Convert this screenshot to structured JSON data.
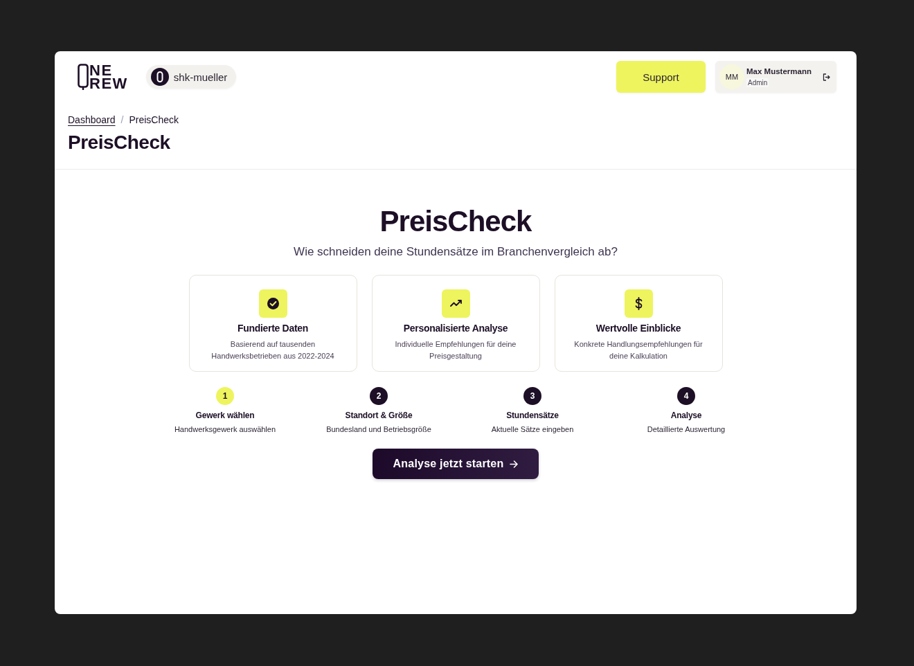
{
  "header": {
    "logo": {
      "top": "NE",
      "bottom": "REW"
    },
    "workspace": "shk-mueller",
    "support_button": "Support",
    "user": {
      "initials": "MM",
      "name": "Max Mustermann",
      "role": "Admin"
    }
  },
  "breadcrumb": {
    "items": [
      {
        "label": "Dashboard",
        "link": true
      },
      {
        "label": "PreisCheck",
        "link": false
      }
    ],
    "separator": "/"
  },
  "page_title": "PreisCheck",
  "hero": {
    "title": "PreisCheck",
    "subtitle": "Wie schneiden deine Stundensätze im Branchenvergleich ab?"
  },
  "features": [
    {
      "title": "Fundierte Daten",
      "description": "Basierend auf tausenden Handwerksbetrieben aus 2022-2024"
    },
    {
      "title": "Personalisierte Analyse",
      "description": "Individuelle Empfehlungen für deine Preisgestaltung"
    },
    {
      "title": "Wertvolle Einblicke",
      "description": "Konkrete Handlungsempfehlungen für deine Kalkulation"
    }
  ],
  "steps": [
    {
      "number": "1",
      "title": "Gewerk wählen",
      "description": "Handwerksgewerk auswählen",
      "current": true
    },
    {
      "number": "2",
      "title": "Standort & Größe",
      "description": "Bundesland und Betriebsgröße",
      "current": false
    },
    {
      "number": "3",
      "title": "Stundensätze",
      "description": "Aktuelle Sätze eingeben",
      "current": false
    },
    {
      "number": "4",
      "title": "Analyse",
      "description": "Detaillierte Auswertung",
      "current": false
    }
  ],
  "cta_button": "Analyse jetzt starten"
}
